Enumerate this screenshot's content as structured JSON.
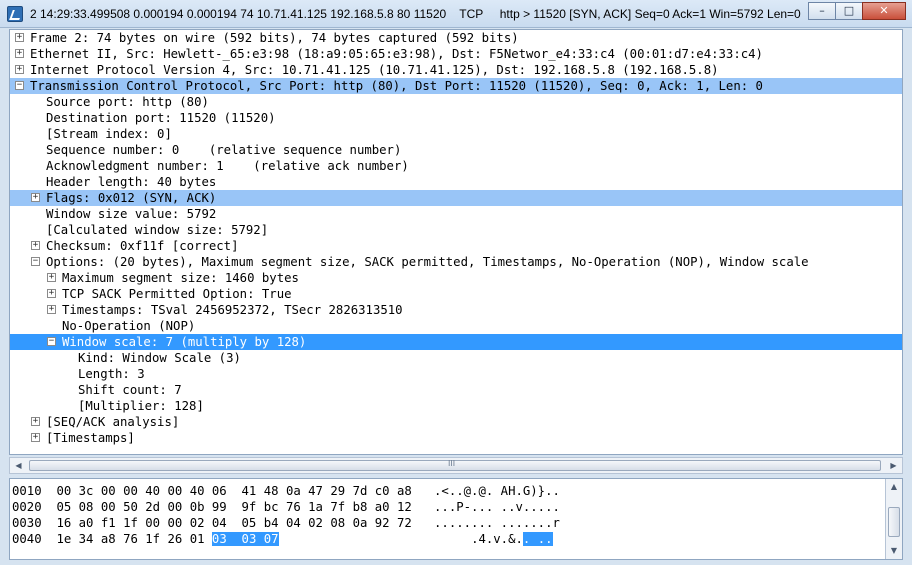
{
  "window": {
    "title": "2 14:29:33.499508 0.000194 0.000194 74 10.71.41.125 192.168.5.8 80 11520    TCP     http > 11520 [SYN, ACK] Seq=0 Ack=1 Win=5792 Len=0",
    "minimize": "–",
    "maximize": "□",
    "close": "✕"
  },
  "tree": [
    {
      "text": "Frame 2: 74 bytes on wire (592 bits), 74 bytes captured (592 bits)",
      "toggle": "+"
    },
    {
      "text": "Ethernet II, Src: Hewlett-_65:e3:98 (18:a9:05:65:e3:98), Dst: F5Networ_e4:33:c4 (00:01:d7:e4:33:c4)",
      "toggle": "+"
    },
    {
      "text": "Internet Protocol Version 4, Src: 10.71.41.125 (10.71.41.125), Dst: 192.168.5.8 (192.168.5.8)",
      "toggle": "+"
    },
    {
      "text": "Transmission Control Protocol, Src Port: http (80), Dst Port: 11520 (11520), Seq: 0, Ack: 1, Len: 0",
      "toggle": "−"
    },
    {
      "text": "Source port: http (80)",
      "toggle": ""
    },
    {
      "text": "Destination port: 11520 (11520)",
      "toggle": ""
    },
    {
      "text": "[Stream index: 0]",
      "toggle": ""
    },
    {
      "text": "Sequence number: 0    (relative sequence number)",
      "toggle": ""
    },
    {
      "text": "Acknowledgment number: 1    (relative ack number)",
      "toggle": ""
    },
    {
      "text": "Header length: 40 bytes",
      "toggle": ""
    },
    {
      "text": "Flags: 0x012 (SYN, ACK)",
      "toggle": "+"
    },
    {
      "text": "Window size value: 5792",
      "toggle": ""
    },
    {
      "text": "[Calculated window size: 5792]",
      "toggle": ""
    },
    {
      "text": "Checksum: 0xf11f [correct]",
      "toggle": "+"
    },
    {
      "text": "Options: (20 bytes), Maximum segment size, SACK permitted, Timestamps, No-Operation (NOP), Window scale",
      "toggle": "−"
    },
    {
      "text": "Maximum segment size: 1460 bytes",
      "toggle": "+"
    },
    {
      "text": "TCP SACK Permitted Option: True",
      "toggle": "+"
    },
    {
      "text": "Timestamps: TSval 2456952372, TSecr 2826313510",
      "toggle": "+"
    },
    {
      "text": "No-Operation (NOP)",
      "toggle": ""
    },
    {
      "text": "Window scale: 7 (multiply by 128)",
      "toggle": "−"
    },
    {
      "text": "Kind: Window Scale (3)",
      "toggle": ""
    },
    {
      "text": "Length: 3",
      "toggle": ""
    },
    {
      "text": "Shift count: 7",
      "toggle": ""
    },
    {
      "text": "[Multiplier: 128]",
      "toggle": ""
    },
    {
      "text": "[SEQ/ACK analysis]",
      "toggle": "+"
    },
    {
      "text": "[Timestamps]",
      "toggle": "+"
    }
  ],
  "hscroll": {
    "left": "◀",
    "right": "▶",
    "grip": "III"
  },
  "hex": [
    {
      "offset": "0010",
      "bytes": "00 3c 00 00 40 00 40 06  41 48 0a 47 29 7d c0 a8",
      "bytes_hl": "",
      "ascii": ".<..@.@. AH.G)}..",
      "ascii_hl": ""
    },
    {
      "offset": "0020",
      "bytes": "05 08 00 50 2d 00 0b 99  9f bc 76 1a 7f b8 a0 12",
      "bytes_hl": "",
      "ascii": "...P-... ..v.....",
      "ascii_hl": ""
    },
    {
      "offset": "0030",
      "bytes": "16 a0 f1 1f 00 00 02 04  05 b4 04 02 08 0a 92 72",
      "bytes_hl": "",
      "ascii": "........ .......r",
      "ascii_hl": ""
    },
    {
      "offset": "0040",
      "bytes": "1e 34 a8 76 1f 26 01 ",
      "bytes_hl": "03  03 07",
      "ascii": ".4.v.&.",
      "ascii_hl": ". .."
    }
  ],
  "vscroll": {
    "up": "▲",
    "down": "▼"
  },
  "colors": {
    "selected_row": "#99c5f7",
    "focus_row": "#3399ff"
  }
}
